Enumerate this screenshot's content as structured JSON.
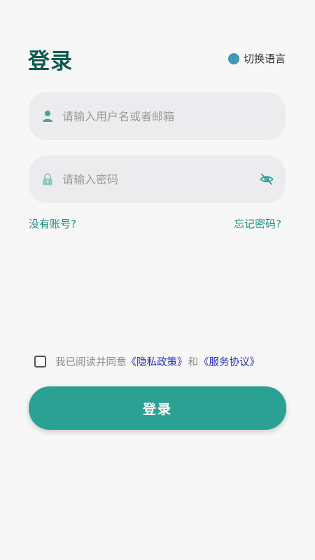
{
  "header": {
    "title": "登录",
    "language_switch_label": "切换语言",
    "language_icon": "globe-icon"
  },
  "form": {
    "username": {
      "placeholder": "请输入用户名或者邮箱",
      "value": "",
      "icon": "user-icon"
    },
    "password": {
      "placeholder": "请输入密码",
      "value": "",
      "icon": "lock-icon",
      "toggle_icon": "eye-off-icon"
    },
    "no_account_link": "没有账号?",
    "forgot_password_link": "忘记密码?"
  },
  "agreement": {
    "checked": false,
    "prefix": "我已阅读并同意",
    "privacy_policy": "《隐私政策》",
    "and": "和",
    "service_agreement": "《服务协议》"
  },
  "login_button_label": "登录",
  "colors": {
    "background": "#f7f7f8",
    "title": "#0e5a4f",
    "accent": "#2aa193",
    "link": "#1e8c7e",
    "policy_link": "#2630b8",
    "field_bg": "#ececee"
  }
}
